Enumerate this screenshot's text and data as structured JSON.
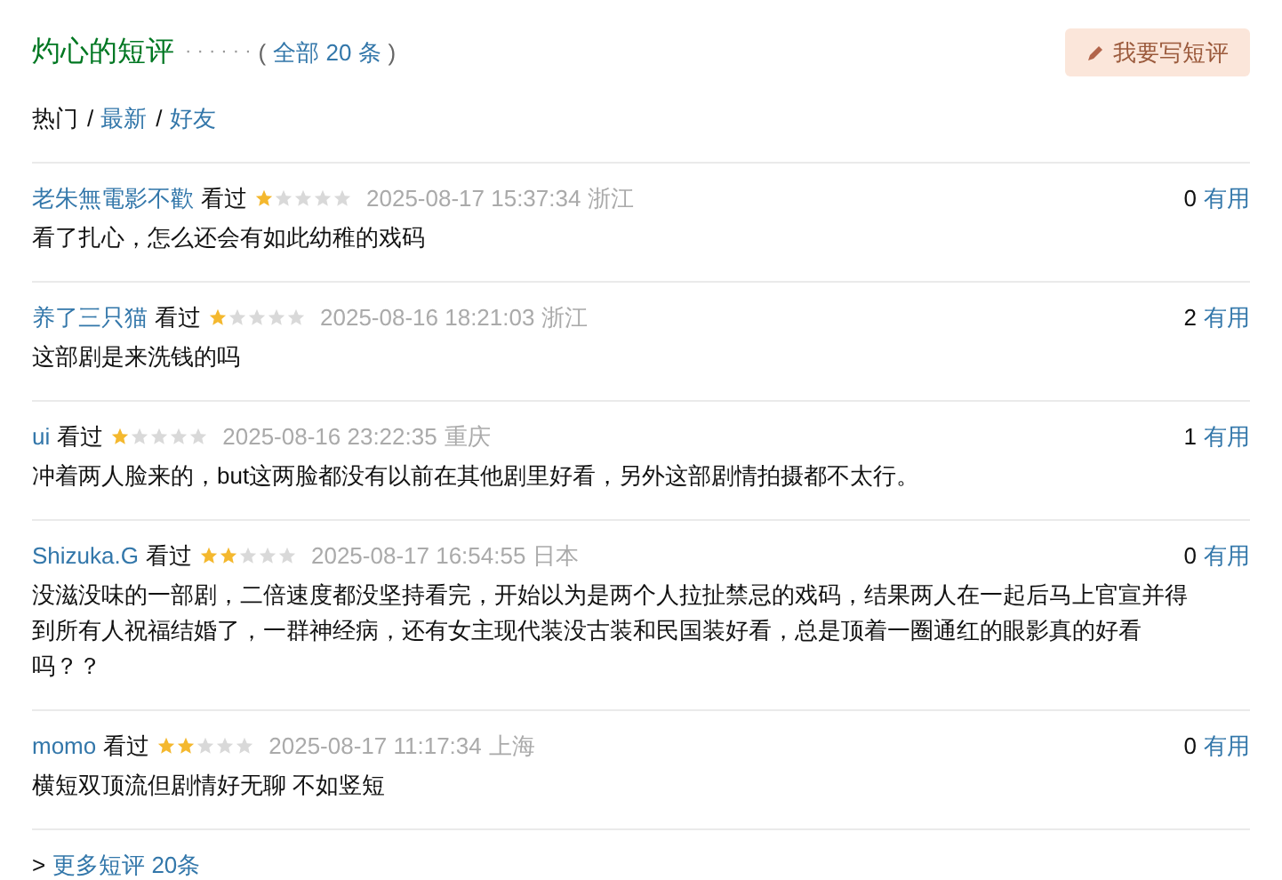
{
  "header": {
    "title": "灼心的短评",
    "dots": "· · · · · ·",
    "count_open": "(",
    "count_link": "全部 20 条",
    "count_close": ")",
    "write_button": "我要写短评"
  },
  "tabs": [
    {
      "label": "热门",
      "separator": "/",
      "selected": true
    },
    {
      "label": "最新",
      "separator": "/",
      "selected": false
    },
    {
      "label": "好友",
      "selected": false
    }
  ],
  "comments": [
    {
      "user": "老朱無電影不歡",
      "status": "看过",
      "stars": 1,
      "time": "2025-08-17 15:37:34",
      "location": "浙江",
      "votes": "0",
      "vote_label": "有用",
      "text": "看了扎心，怎么还会有如此幼稚的戏码"
    },
    {
      "user": "养了三只猫",
      "status": "看过",
      "stars": 1,
      "time": "2025-08-16 18:21:03",
      "location": "浙江",
      "votes": "2",
      "vote_label": "有用",
      "text": "这部剧是来洗钱的吗"
    },
    {
      "user": "ui",
      "status": "看过",
      "stars": 1,
      "time": "2025-08-16 23:22:35",
      "location": "重庆",
      "votes": "1",
      "vote_label": "有用",
      "text": "冲着两人脸来的，but这两脸都没有以前在其他剧里好看，另外这部剧情拍摄都不太行。"
    },
    {
      "user": "Shizuka.G",
      "status": "看过",
      "stars": 2,
      "time": "2025-08-17 16:54:55",
      "location": "日本",
      "votes": "0",
      "vote_label": "有用",
      "text": "没滋没味的一部剧，二倍速度都没坚持看完，开始以为是两个人拉扯禁忌的戏码，结果两人在一起后马上官宣并得到所有人祝福结婚了，一群神经病，还有女主现代装没古装和民国装好看，总是顶着一圈通红的眼影真的好看吗？？"
    },
    {
      "user": "momo",
      "status": "看过",
      "stars": 2,
      "time": "2025-08-17 11:17:34",
      "location": "上海",
      "votes": "0",
      "vote_label": "有用",
      "text": "横短双顶流但剧情好无聊 不如竖短"
    }
  ],
  "more": {
    "arrow": ">",
    "link": "更多短评 20条"
  }
}
